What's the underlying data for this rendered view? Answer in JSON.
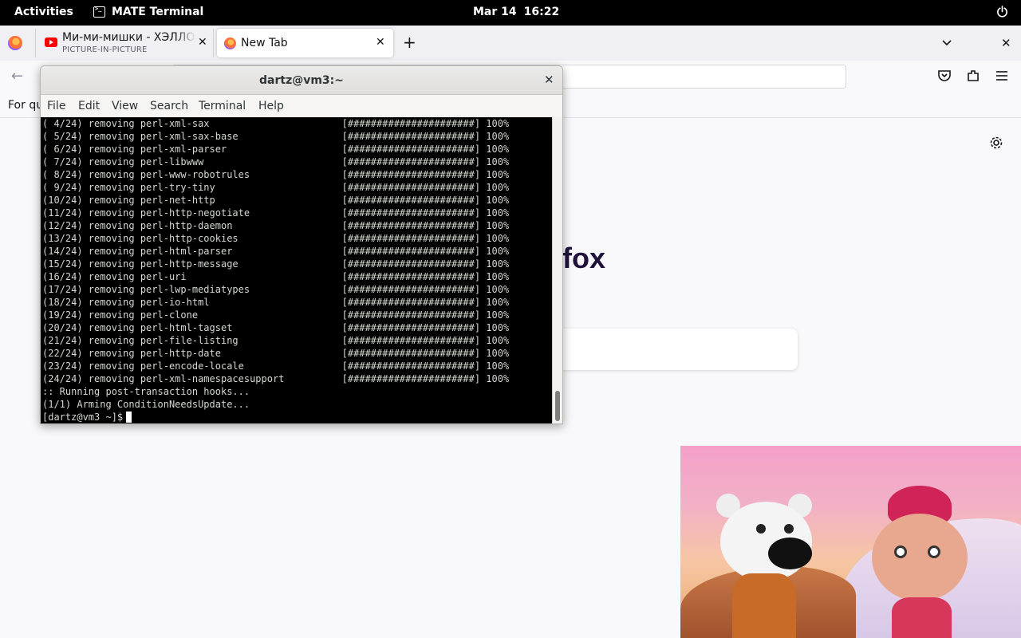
{
  "topbar": {
    "activities": "Activities",
    "app_name": "MATE Terminal",
    "date": "Mar 14",
    "time": "16:22",
    "power_icon": "power-icon"
  },
  "browser": {
    "tabs": [
      {
        "title": "Ми-ми-мишки - ХЭЛЛОУ",
        "subtitle": "PICTURE-IN-PICTURE",
        "icon": "youtube-icon"
      },
      {
        "title": "New Tab",
        "icon": "firefox-icon"
      }
    ],
    "new_tab_glyph": "+",
    "bookmarks_item": "For qu",
    "page_brand_fragment": "fox"
  },
  "terminal": {
    "title": "dartz@vm3:~",
    "menu": [
      "File",
      "Edit",
      "View",
      "Search",
      "Terminal",
      "Help"
    ],
    "lines": [
      "( 4/24) removing perl-xml-sax                       [######################] 100%",
      "( 5/24) removing perl-xml-sax-base                  [######################] 100%",
      "( 6/24) removing perl-xml-parser                    [######################] 100%",
      "( 7/24) removing perl-libwww                        [######################] 100%",
      "( 8/24) removing perl-www-robotrules                [######################] 100%",
      "( 9/24) removing perl-try-tiny                      [######################] 100%",
      "(10/24) removing perl-net-http                      [######################] 100%",
      "(11/24) removing perl-http-negotiate                [######################] 100%",
      "(12/24) removing perl-http-daemon                   [######################] 100%",
      "(13/24) removing perl-http-cookies                  [######################] 100%",
      "(14/24) removing perl-html-parser                   [######################] 100%",
      "(15/24) removing perl-http-message                  [######################] 100%",
      "(16/24) removing perl-uri                           [######################] 100%",
      "(17/24) removing perl-lwp-mediatypes                [######################] 100%",
      "(18/24) removing perl-io-html                       [######################] 100%",
      "(19/24) removing perl-clone                         [######################] 100%",
      "(20/24) removing perl-html-tagset                   [######################] 100%",
      "(21/24) removing perl-file-listing                  [######################] 100%",
      "(22/24) removing perl-http-date                     [######################] 100%",
      "(23/24) removing perl-encode-locale                 [######################] 100%",
      "(24/24) removing perl-xml-namespacesupport          [######################] 100%",
      ":: Running post-transaction hooks...",
      "(1/1) Arming ConditionNeedsUpdate..."
    ],
    "prompt": "[dartz@vm3 ~]$"
  }
}
